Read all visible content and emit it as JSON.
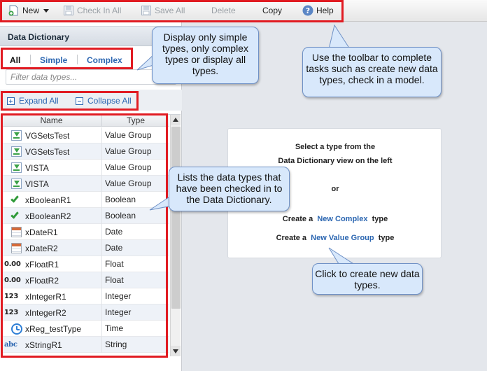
{
  "toolbar": {
    "new_label": "New",
    "checkin_label": "Check In All",
    "save_label": "Save All",
    "delete_label": "Delete",
    "copy_label": "Copy",
    "help_label": "Help"
  },
  "left_panel": {
    "title": "Data Dictionary",
    "tabs": [
      "All",
      "Simple",
      "Complex"
    ],
    "filter_placeholder": "Filter data types...",
    "expand_all_label": "Expand All",
    "collapse_all_label": "Collapse All",
    "columns": [
      "Name",
      "Type"
    ],
    "rows": [
      {
        "icon": "value-group-icon",
        "name": "VGSetsTest",
        "type": "Value Group"
      },
      {
        "icon": "value-group-icon",
        "name": "VGSetsTest",
        "type": "Value Group"
      },
      {
        "icon": "value-group-icon",
        "name": "VISTA",
        "type": "Value Group"
      },
      {
        "icon": "value-group-icon",
        "name": "VISTA",
        "type": "Value Group"
      },
      {
        "icon": "checkmark-icon",
        "name": "xBooleanR1",
        "type": "Boolean"
      },
      {
        "icon": "checkmark-icon",
        "name": "xBooleanR2",
        "type": "Boolean"
      },
      {
        "icon": "calendar-icon",
        "name": "xDateR1",
        "type": "Date"
      },
      {
        "icon": "calendar-icon",
        "name": "xDateR2",
        "type": "Date"
      },
      {
        "icon": "float-icon",
        "icon_text": "0.00",
        "name": "xFloatR1",
        "type": "Float"
      },
      {
        "icon": "float-icon",
        "icon_text": "0.00",
        "name": "xFloatR2",
        "type": "Float"
      },
      {
        "icon": "integer-icon",
        "icon_text": "123",
        "name": "xIntegerR1",
        "type": "Integer"
      },
      {
        "icon": "integer-icon",
        "icon_text": "123",
        "name": "xIntegerR2",
        "type": "Integer"
      },
      {
        "icon": "clock-icon",
        "name": "xReg_testType",
        "type": "Time"
      },
      {
        "icon": "string-icon",
        "icon_text": "abc",
        "name": "xStringR1",
        "type": "String"
      }
    ]
  },
  "main": {
    "line1": "Select a type from the",
    "line2": "Data Dictionary view on the left",
    "or_label": "or",
    "create_prefix": "Create a",
    "create_suffix": "type",
    "new_complex_link": "New Complex",
    "new_value_group_link": "New Value Group"
  },
  "callouts": {
    "filter": "Display only simple types, only complex types or display all types.",
    "toolbar": "Use the toolbar to complete tasks such as create new data types, check in a model.",
    "grid": "Lists the data types that have been checked in to the Data Dictionary.",
    "click": "Click to create new data types."
  },
  "colors": {
    "highlight": "#e11b22",
    "callout_fill": "#d8e8fb",
    "callout_border": "#6f91c6",
    "link": "#2b66b1"
  }
}
